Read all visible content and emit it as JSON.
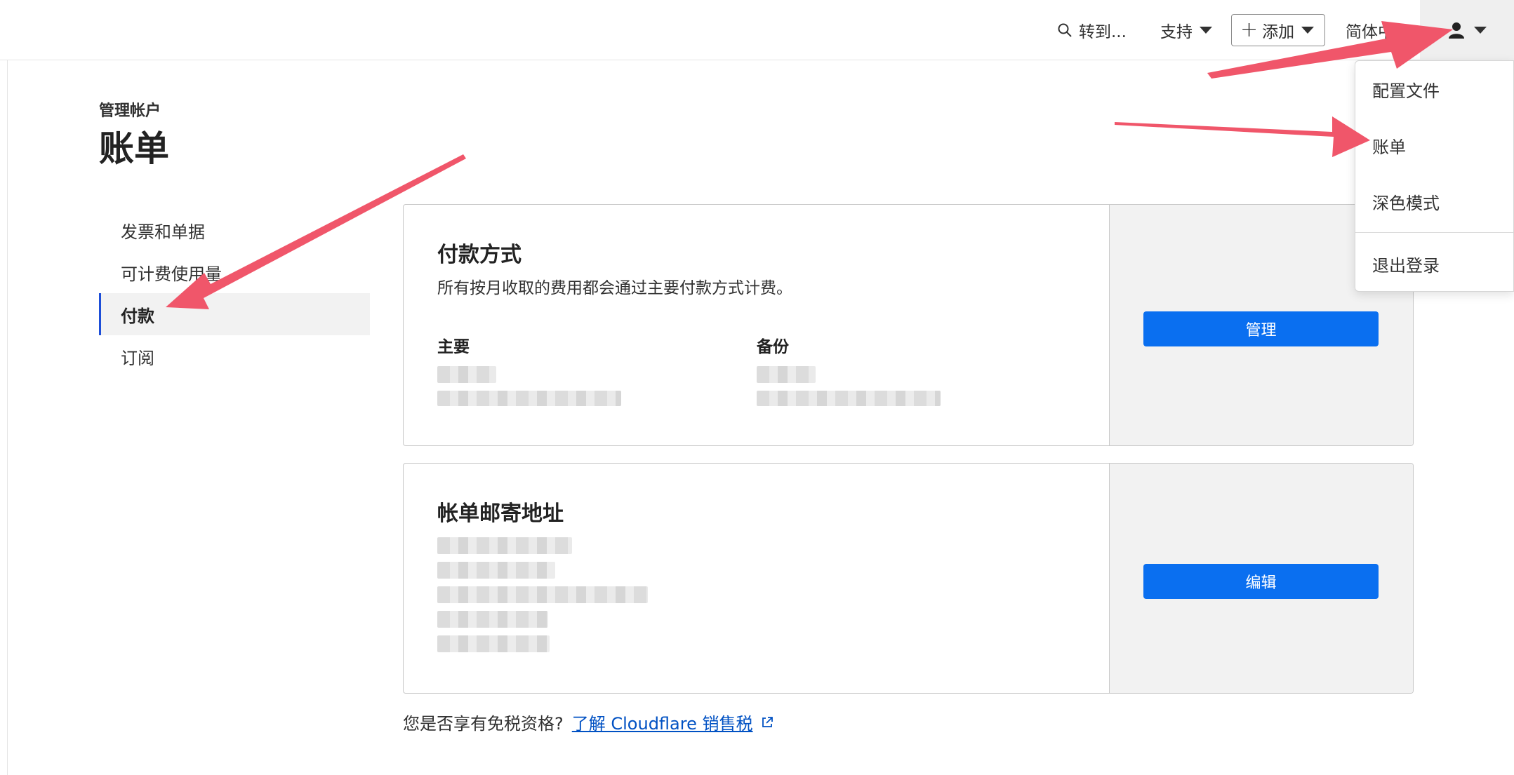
{
  "topbar": {
    "search_label": "转到...",
    "support_label": "支持",
    "add_label": "添加",
    "language_label": "简体中文"
  },
  "header": {
    "breadcrumb": "管理帐户",
    "title": "账单"
  },
  "side_nav": {
    "items": [
      {
        "label": "发票和单据"
      },
      {
        "label": "可计费使用量"
      },
      {
        "label": "付款"
      },
      {
        "label": "订阅"
      }
    ],
    "active_index": 2
  },
  "payment_card": {
    "title": "付款方式",
    "description": "所有按月收取的费用都会通过主要付款方式计费。",
    "primary_label": "主要",
    "backup_label": "备份",
    "manage_button": "管理"
  },
  "address_card": {
    "title": "帐单邮寄地址",
    "edit_button": "编辑"
  },
  "tax": {
    "question": "您是否享有免税资格?",
    "link_text": "了解 Cloudflare 销售税"
  },
  "user_menu": {
    "items": [
      {
        "label": "配置文件"
      },
      {
        "label": "账单"
      },
      {
        "label": "深色模式"
      },
      {
        "label": "退出登录"
      }
    ]
  },
  "colors": {
    "accent_blue": "#0a6ff0",
    "link_blue": "#0051c3",
    "annotation_arrow": "#f0566a"
  }
}
